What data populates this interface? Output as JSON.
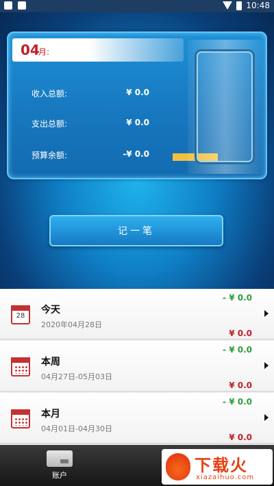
{
  "status_bar": {
    "time": "10:48"
  },
  "summary": {
    "month_number": "04",
    "month_unit": "月:",
    "rows": [
      {
        "label": "收入总额:",
        "value": "¥ 0.0"
      },
      {
        "label": "支出总额:",
        "value": "¥ 0.0"
      },
      {
        "label": "预算余额:",
        "value": "-¥ 0.0"
      }
    ]
  },
  "record_button": {
    "label": "记一笔"
  },
  "periods": [
    {
      "title": "今天",
      "range": "2020年04月28日",
      "expense": "- ¥ 0.0",
      "income": "¥ 0.0",
      "calendar_day": "28"
    },
    {
      "title": "本周",
      "range": "04月27日-05月03日",
      "expense": "- ¥ 0.0",
      "income": "¥ 0.0"
    },
    {
      "title": "本月",
      "range": "04月01日-04月30日",
      "expense": "- ¥ 0.0",
      "income": "¥ 0.0"
    }
  ],
  "tabbar": {
    "account_label": "账户"
  },
  "watermark": {
    "title": "下载火",
    "subtitle": "xiazaihuo.com"
  },
  "colors": {
    "income_red": "#c0202a",
    "expense_green": "#2c9e3a",
    "accent_blue": "#1679c4"
  }
}
